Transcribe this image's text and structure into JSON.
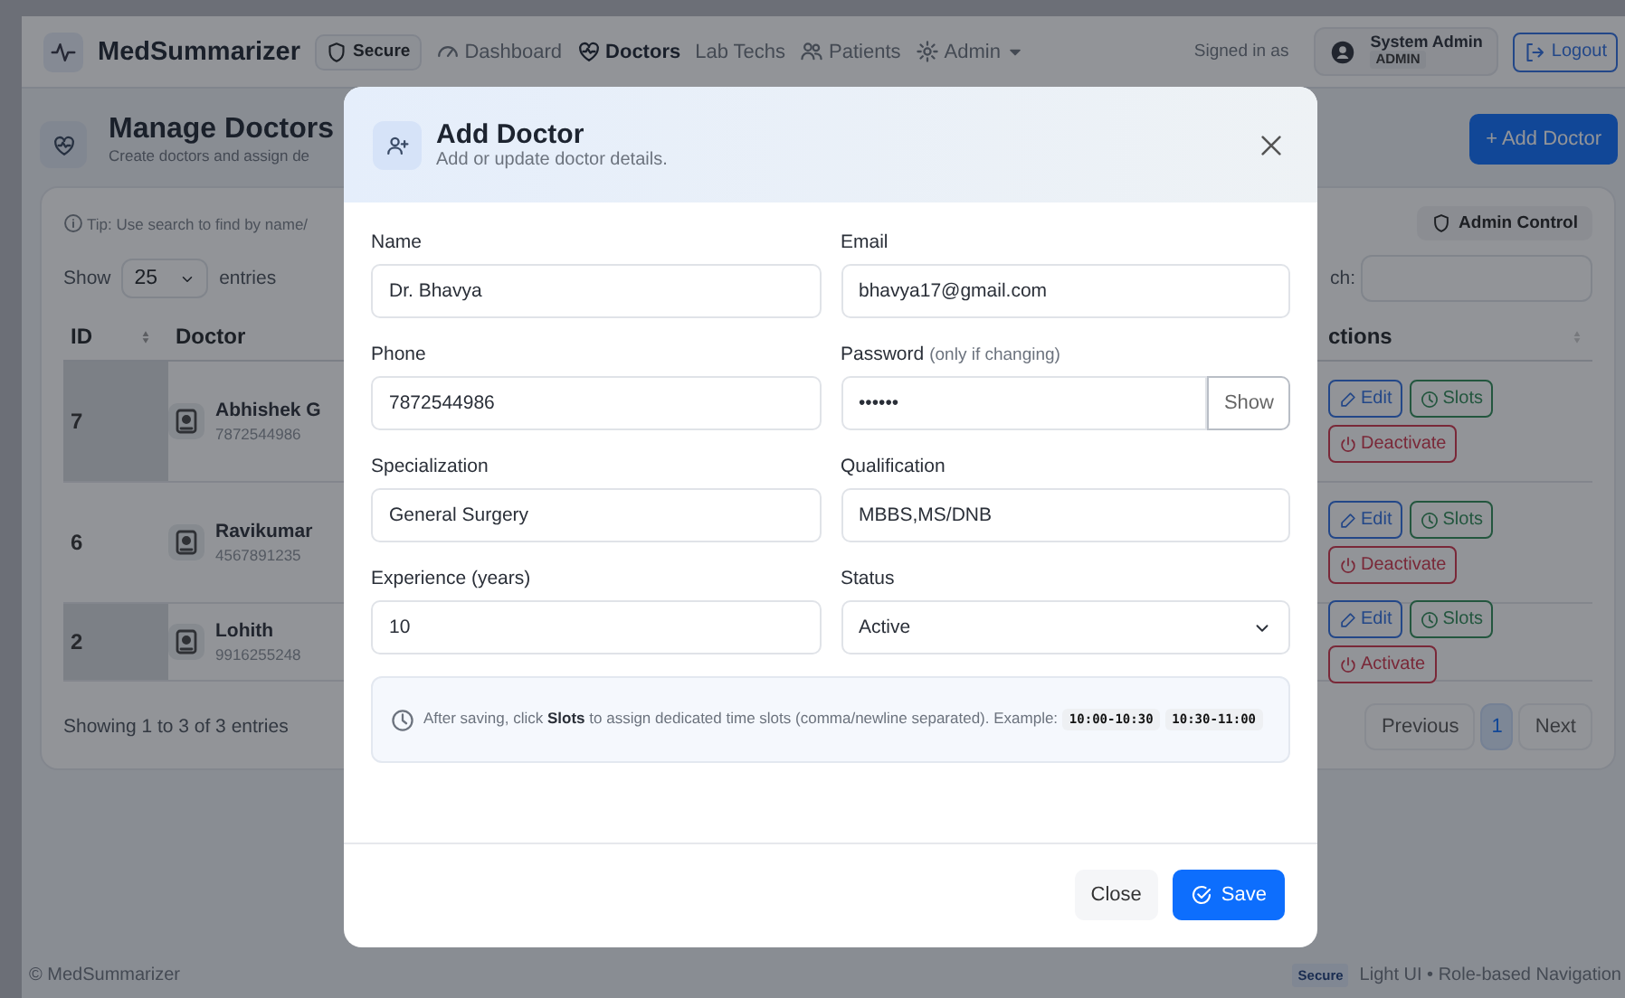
{
  "navbar": {
    "brand": "MedSummarizer",
    "badge": "Secure",
    "items": [
      {
        "label": "Dashboard",
        "selected": false,
        "menu": false
      },
      {
        "label": "Doctors",
        "selected": true,
        "menu": false
      },
      {
        "label": "Lab Techs",
        "selected": false,
        "menu": false
      },
      {
        "label": "Patients",
        "selected": false,
        "menu": false
      },
      {
        "label": "Admin",
        "selected": false,
        "menu": true
      }
    ],
    "signed_in_label": "Signed in as",
    "user_name": "System Admin",
    "user_role": "ADMIN",
    "logout": "Logout"
  },
  "header": {
    "title": "Manage Doctors",
    "subtitle": "Create doctors and assign de",
    "add_button": "+ Add Doctor"
  },
  "card": {
    "tip": "Tip: Use search to find by name/",
    "badge": "Admin Control",
    "show_label": "Show",
    "page_size": "25",
    "entries_label": "entries",
    "search_label": "ch:",
    "columns": [
      "ID",
      "Doctor",
      "ctions"
    ],
    "rows": [
      {
        "id": "7",
        "name": "Abhishek G",
        "phone": "7872544986",
        "shaded": true,
        "actions": [
          {
            "kind": "edit",
            "label": "Edit"
          },
          {
            "kind": "slots",
            "label": "Slots"
          },
          {
            "kind": "deactivate",
            "label": "Deactivate"
          }
        ]
      },
      {
        "id": "6",
        "name": "Ravikumar",
        "phone": "4567891235",
        "shaded": false,
        "actions": [
          {
            "kind": "edit",
            "label": "Edit"
          },
          {
            "kind": "slots",
            "label": "Slots"
          },
          {
            "kind": "deactivate",
            "label": "Deactivate"
          }
        ]
      },
      {
        "id": "2",
        "name": "Lohith",
        "phone": "9916255248",
        "shaded": true,
        "actions": [
          {
            "kind": "edit",
            "label": "Edit"
          },
          {
            "kind": "slots",
            "label": "Slots"
          },
          {
            "kind": "activate",
            "label": "Activate"
          }
        ]
      }
    ],
    "info": "Showing 1 to 3 of 3 entries",
    "pagination": [
      {
        "label": "Previous",
        "selected": false
      },
      {
        "label": "1",
        "selected": true
      },
      {
        "label": "Next",
        "selected": false
      }
    ]
  },
  "footer": {
    "copyright": "© MedSummarizer",
    "badge": "Secure",
    "note": "Light UI • Role-based Navigation"
  },
  "modal": {
    "title": "Add Doctor",
    "subtitle": "Add or update doctor details.",
    "fields": [
      {
        "kind": "text",
        "label": "Name",
        "value": "Dr. Bhavya"
      },
      {
        "kind": "text",
        "label": "Email",
        "value": "bhavya17@gmail.com"
      },
      {
        "kind": "text",
        "label": "Phone",
        "value": "7872544986"
      },
      {
        "kind": "password",
        "label": "Password",
        "note": "(only if changing)",
        "value": "••••••",
        "button": "Show"
      },
      {
        "kind": "text",
        "label": "Specialization",
        "value": "General Surgery"
      },
      {
        "kind": "text",
        "label": "Qualification",
        "value": "MBBS,MS/DNB"
      },
      {
        "kind": "text",
        "label": "Experience (years)",
        "value": "10"
      },
      {
        "kind": "select",
        "label": "Status",
        "value": "Active"
      }
    ],
    "hint": "After saving, click **Slots** to assign dedicated time slots (comma/newline separated). Example:",
    "examples": [
      "10:00-10:30",
      "10:30-11:00"
    ],
    "close": "Close",
    "save": "Save"
  }
}
